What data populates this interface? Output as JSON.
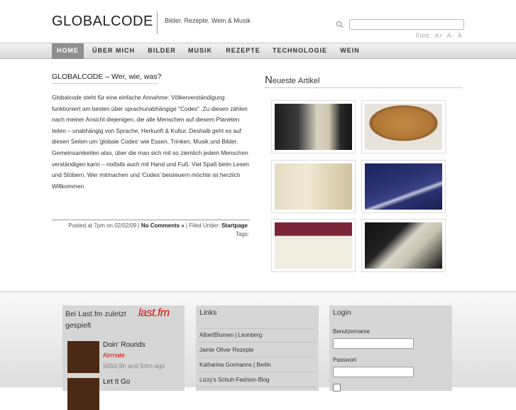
{
  "header": {
    "logo": "GLOBALCODE",
    "tagline": "Bilder. Rezepte. Wein & Musik",
    "search_placeholder": "",
    "font_label": "Font:",
    "font_larger": "A+",
    "font_smaller": "A-",
    "font_reset": "A"
  },
  "nav": {
    "items": [
      "HOME",
      "ÜBER MICH",
      "BILDER",
      "MUSIK",
      "REZEPTE",
      "TECHNOLOGIE",
      "WEIN"
    ],
    "active": "HOME"
  },
  "post": {
    "title": "GLOBALCODE – Wer, wie, was?",
    "body": "Globalcode steht für eine einfache Annahme: Völkerverständigung funktioniert am besten über sprachunabhängige \"Codes\". Zu diesen zählen nach meiner Ansicht diejenigen, die alle Menschen auf diesem Planeten teilen – unabhängig von Sprache, Herkunft & Kultur. Deshalb geht es auf diesen Seiten um 'globale Codes' wie Essen, Trinken, Musik und Bilder. Gemeinsamkeiten also, über die man sich mit so ziemlich jedem Menschen verständigen kann – notfalls auch mit Hand und Fuß. Viel Spaß beim Lesen und Stöbern. Wer mitmachen und 'Codes' beisteuern möchte ist herzlich Willkommen.",
    "meta_prefix": "Posted at 7pm on 02/02/09 | ",
    "comments": "No Comments »",
    "meta_mid": " | Filed Under: ",
    "category": "Startpage",
    "tags_label": "Tags:"
  },
  "recent": {
    "title_initial": "N",
    "title_rest": "euestе Artikel",
    "thumbs": [
      {
        "name": "wine-bottle-label-thumb",
        "colors": [
          "#3a3a3a",
          "#d8d2c0"
        ]
      },
      {
        "name": "crumble-cake-thumb",
        "colors": [
          "#b97a3a",
          "#e8e4dc"
        ]
      },
      {
        "name": "wine-label-cream-thumb",
        "colors": [
          "#e4dcc4",
          "#9a8c60"
        ]
      },
      {
        "name": "blue-wine-bottle-thumb",
        "colors": [
          "#2a3270",
          "#c0c4d8"
        ]
      },
      {
        "name": "philipps-wine-label-thumb",
        "colors": [
          "#7a2438",
          "#f0ece0"
        ]
      },
      {
        "name": "m-logo-wine-label-thumb",
        "colors": [
          "#111111",
          "#d8d4c8"
        ]
      }
    ]
  },
  "lastfm": {
    "title": "Bei Last.fm zuletzt gespielt",
    "logo": "last.fm",
    "tracks": [
      {
        "title": "Doin' Rounds",
        "artist": "Airmate",
        "time": "565d,9h and 54m ago"
      },
      {
        "title": "Let It Go",
        "artist": "",
        "time": ""
      }
    ]
  },
  "links": {
    "title": "Links",
    "items": [
      "AlbertBlumen | Leonberg",
      "Jamie Oliver Rezepte",
      "Katharina Gormanns | Berlin",
      "Lizzy's Schuh-Fashion-Blog"
    ]
  },
  "login": {
    "title": "Login",
    "username_label": "Benutzername",
    "password_label": "Passwort"
  }
}
